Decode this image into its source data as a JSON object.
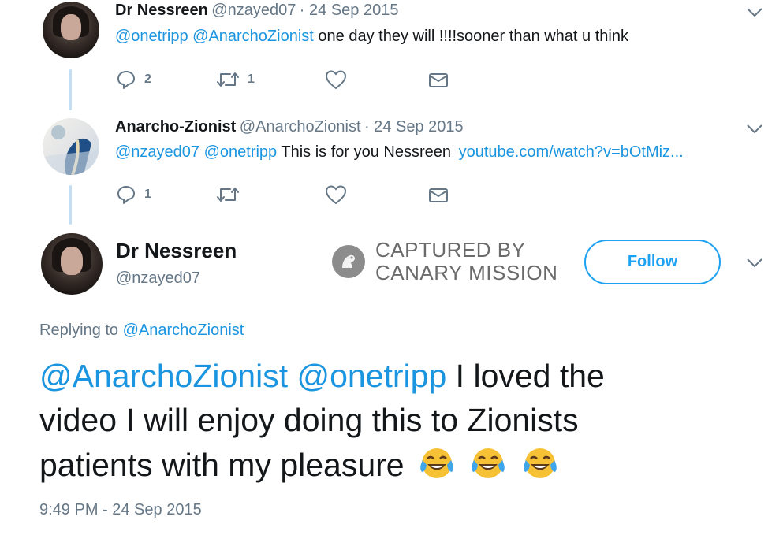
{
  "tweet1": {
    "display_name": "Dr Nessreen",
    "handle": "@nzayed07",
    "date": "· 24 Sep 2015",
    "mentions": "@onetripp @AnarchoZionist",
    "text": "one day they will !!!!sooner than what u think",
    "reply_count": "2",
    "retweet_count": "1"
  },
  "tweet2": {
    "display_name": "Anarcho-Zionist",
    "handle": "@AnarchoZionist",
    "date": "· 24 Sep 2015",
    "mentions": "@nzayed07 @onetripp",
    "text": "This is for you Nessreen",
    "link": "youtube.com/watch?v=bOtMiz...",
    "reply_count": "1"
  },
  "main_tweet": {
    "display_name": "Dr Nessreen",
    "handle": "@nzayed07",
    "follow_label": "Follow",
    "replying_prefix": "Replying to",
    "replying_handle": "@AnarchoZionist",
    "mentions": "@AnarchoZionist @onetripp",
    "text_line1": "I loved  the",
    "text_line2": "video I will enjoy doing this to Zionists",
    "text_line3": "patients with my pleasure",
    "emojis": [
      "face-with-tears-of-joy",
      "face-with-tears-of-joy",
      "face-with-tears-of-joy"
    ],
    "timestamp": "9:49 PM - 24 Sep 2015"
  },
  "watermark": {
    "line1": "CAPTURED BY",
    "line2": "CANARY MISSION"
  },
  "colors": {
    "link": "#1b95e0",
    "secondary_text": "#657786",
    "follow": "#1da1f2",
    "thread_line": "#c4dff3"
  }
}
